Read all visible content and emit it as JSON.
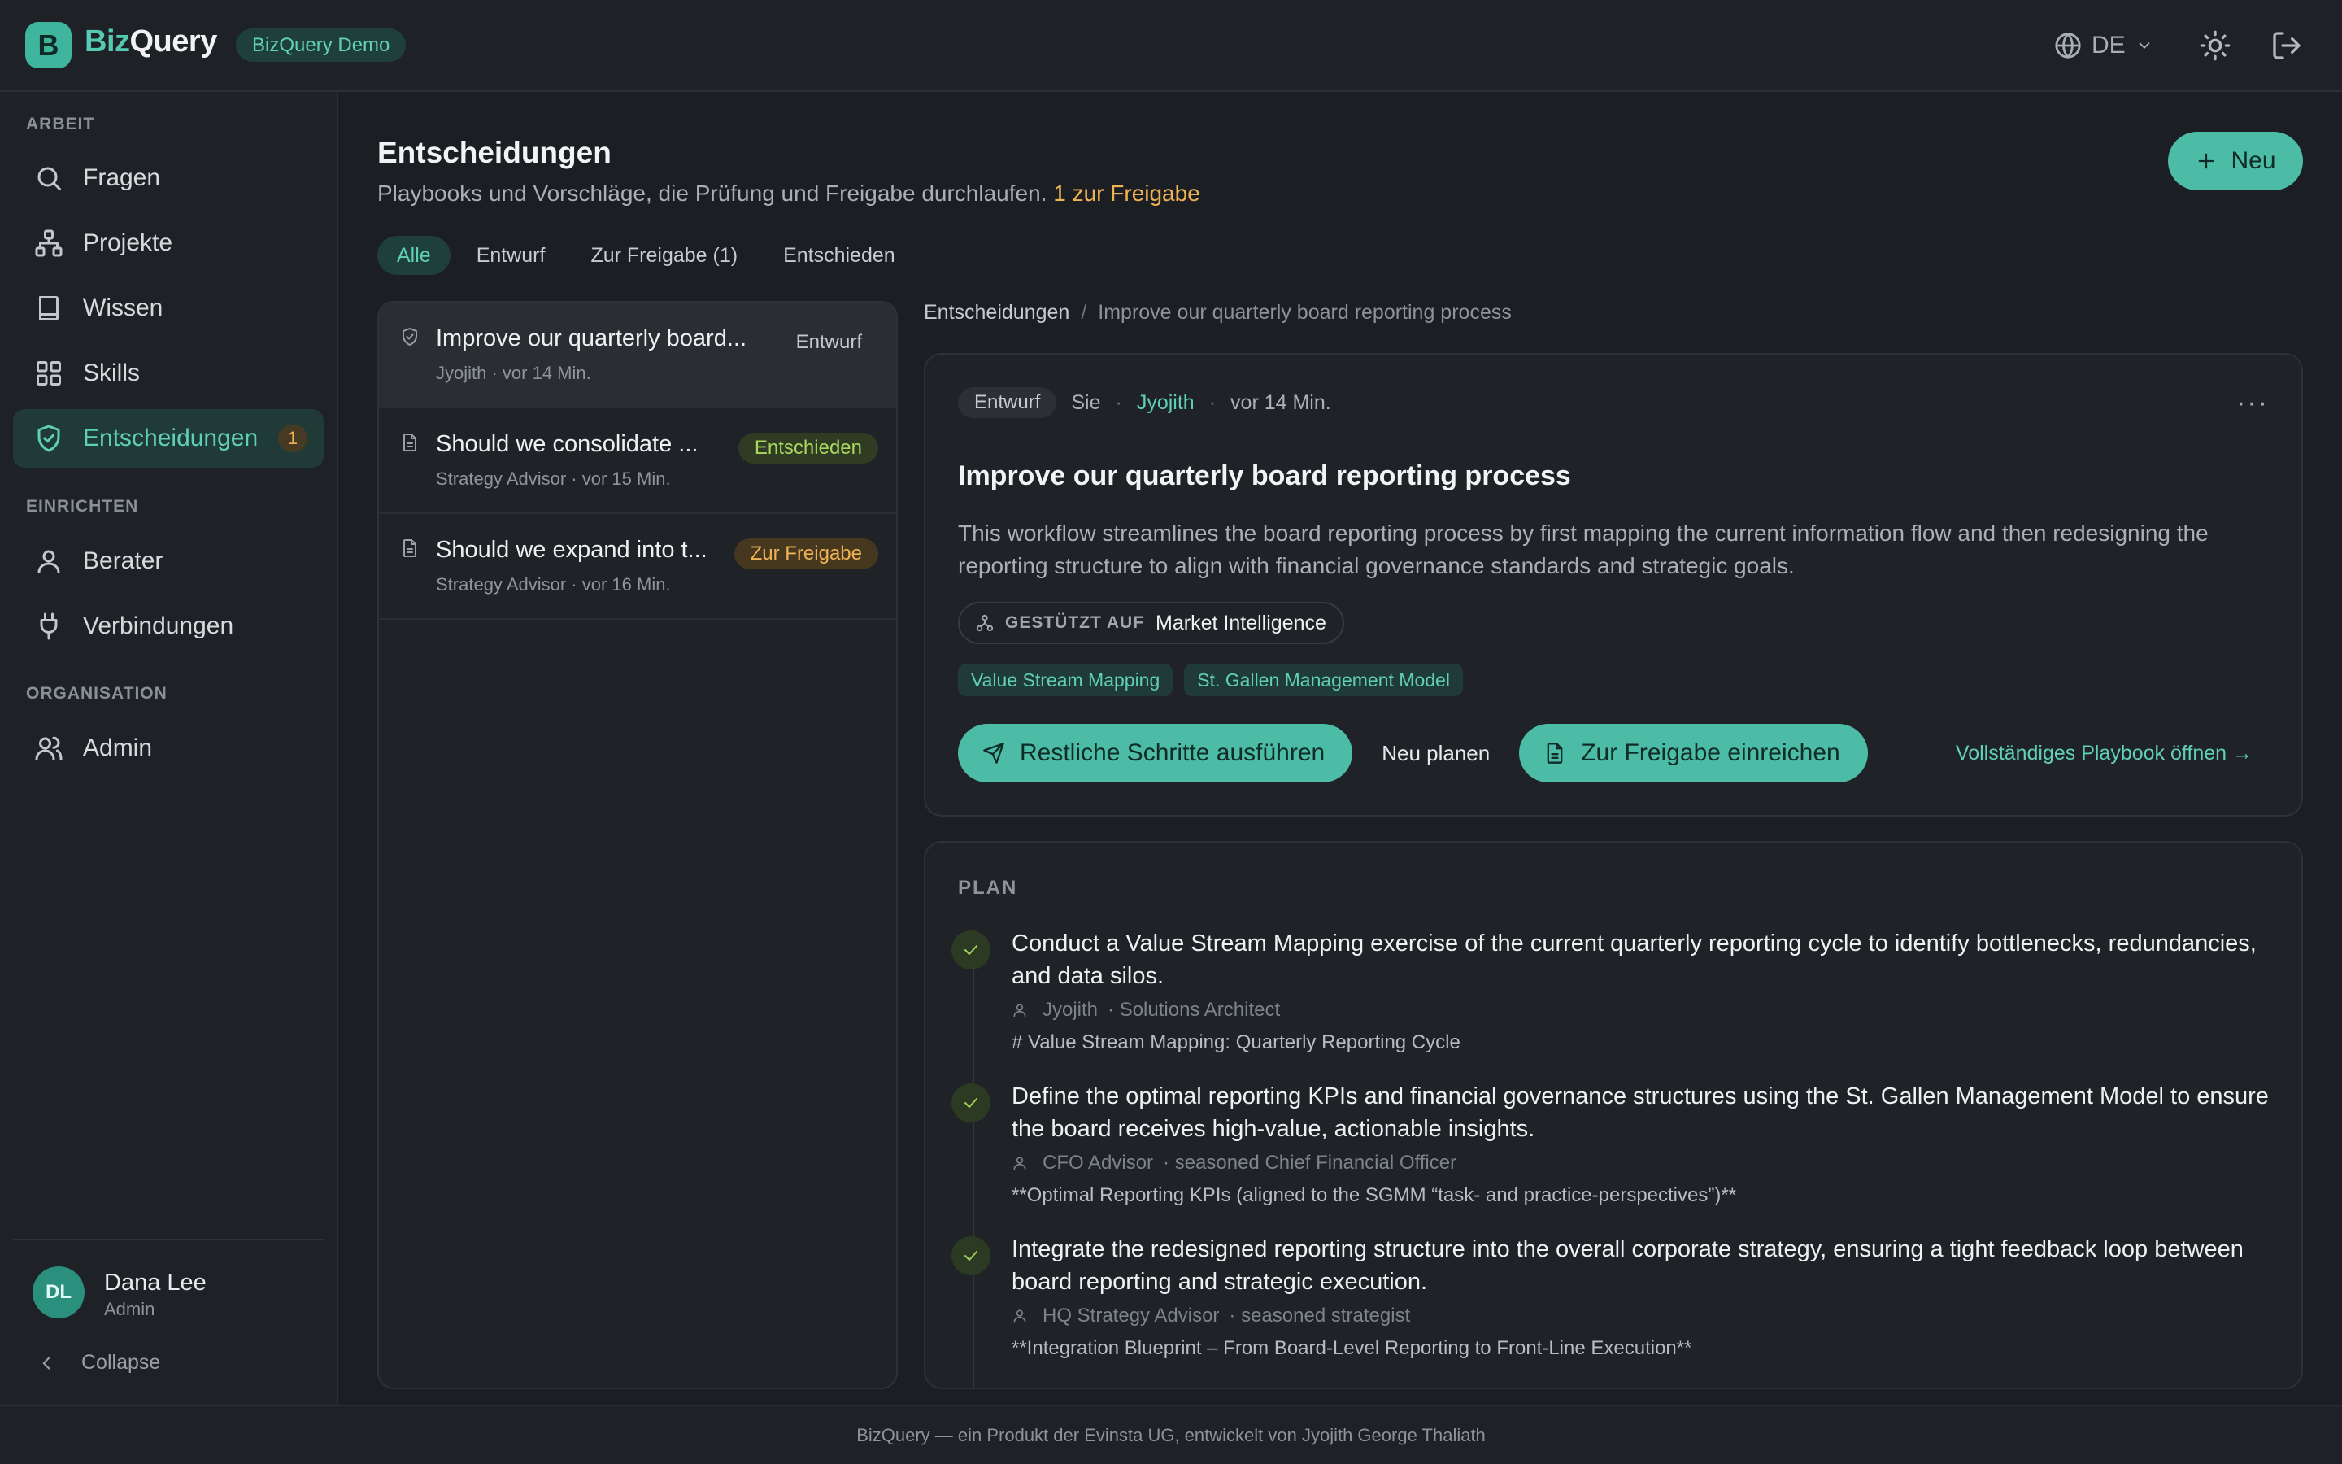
{
  "header": {
    "logo_letter": "B",
    "brand_part1": "Biz",
    "brand_part2": "Query",
    "demo_badge": "BizQuery Demo",
    "language": "DE"
  },
  "sidebar": {
    "section_work": "ARBEIT",
    "section_setup": "EINRICHTEN",
    "section_org": "ORGANISATION",
    "items": [
      {
        "label": "Fragen",
        "icon": "search-icon"
      },
      {
        "label": "Projekte",
        "icon": "hierarchy-icon"
      },
      {
        "label": "Wissen",
        "icon": "book-icon"
      },
      {
        "label": "Skills",
        "icon": "grid-icon"
      },
      {
        "label": "Entscheidungen",
        "icon": "shield-check-icon",
        "badge": "1",
        "active": true
      },
      {
        "label": "Berater",
        "icon": "user-icon"
      },
      {
        "label": "Verbindungen",
        "icon": "plug-icon"
      },
      {
        "label": "Admin",
        "icon": "users-icon"
      }
    ],
    "user": {
      "initials": "DL",
      "name": "Dana Lee",
      "role": "Admin"
    },
    "collapse_label": "Collapse"
  },
  "main": {
    "title": "Entscheidungen",
    "subtitle": "Playbooks und Vorschläge, die Prüfung und Freigabe durchlaufen.",
    "subtitle_highlight": "1 zur Freigabe",
    "new_button": "Neu",
    "tabs": [
      "Alle",
      "Entwurf",
      "Zur Freigabe (1)",
      "Entschieden"
    ],
    "active_tab": "Alle"
  },
  "list": [
    {
      "title": "Improve our quarterly board...",
      "meta": "Jyojith · vor 14 Min.",
      "status": "Entwurf",
      "icon": "shield-icon"
    },
    {
      "title": "Should we consolidate ...",
      "meta": "Strategy Advisor · vor 15 Min.",
      "status": "Entschieden",
      "icon": "document-icon"
    },
    {
      "title": "Should we expand into t...",
      "meta": "Strategy Advisor · vor 16 Min.",
      "status": "Zur Freigabe",
      "icon": "document-icon"
    }
  ],
  "detail": {
    "breadcrumb_root": "Entscheidungen",
    "breadcrumb_sep": "/",
    "breadcrumb_current": "Improve our quarterly board reporting process",
    "status": "Entwurf",
    "owner": "Sie",
    "author": "Jyojith",
    "time": "vor 14 Min.",
    "more": "···",
    "title": "Improve our quarterly board reporting process",
    "description": "This workflow streamlines the board reporting process by first mapping the current information flow and then redesigning the reporting structure to align with financial governance standards and strategic goals.",
    "based_on_label": "GESTÜTZT AUF",
    "based_on_value": "Market Intelligence",
    "tags": [
      "Value Stream Mapping",
      "St. Gallen Management Model"
    ],
    "action_run": "Restliche Schritte ausführen",
    "action_replan": "Neu planen",
    "action_submit": "Zur Freigabe einreichen",
    "open_link": "Vollständiges Playbook öffnen →"
  },
  "plan": {
    "label": "PLAN",
    "steps": [
      {
        "title": "Conduct a Value Stream Mapping exercise of the current quarterly reporting cycle to identify bottlenecks, redundancies, and data silos.",
        "assignee": "Jyojith",
        "role": "· Solutions Architect",
        "note": "# Value Stream Mapping: Quarterly Reporting Cycle"
      },
      {
        "title": "Define the optimal reporting KPIs and financial governance structures using the St. Gallen Management Model to ensure the board receives high-value, actionable insights.",
        "assignee": "CFO Advisor",
        "role": "· seasoned Chief Financial Officer",
        "note": "**Optimal Reporting KPIs (aligned to the SGMM “task- and practice-perspectives”)**"
      },
      {
        "title": "Integrate the redesigned reporting structure into the overall corporate strategy, ensuring a tight feedback loop between board reporting and strategic execution.",
        "assignee": "HQ Strategy Advisor",
        "role": "· seasoned strategist",
        "note": "**Integration Blueprint – From Board-Level Reporting to Front-Line Execution**"
      }
    ]
  },
  "footer": "BizQuery — ein Produkt der Evinsta UG, entwickelt von Jyojith George Thaliath",
  "colors": {
    "accent": "#4cbca6",
    "warning": "#f0b354",
    "success": "#a9d65e",
    "background": "#1b1e22"
  }
}
